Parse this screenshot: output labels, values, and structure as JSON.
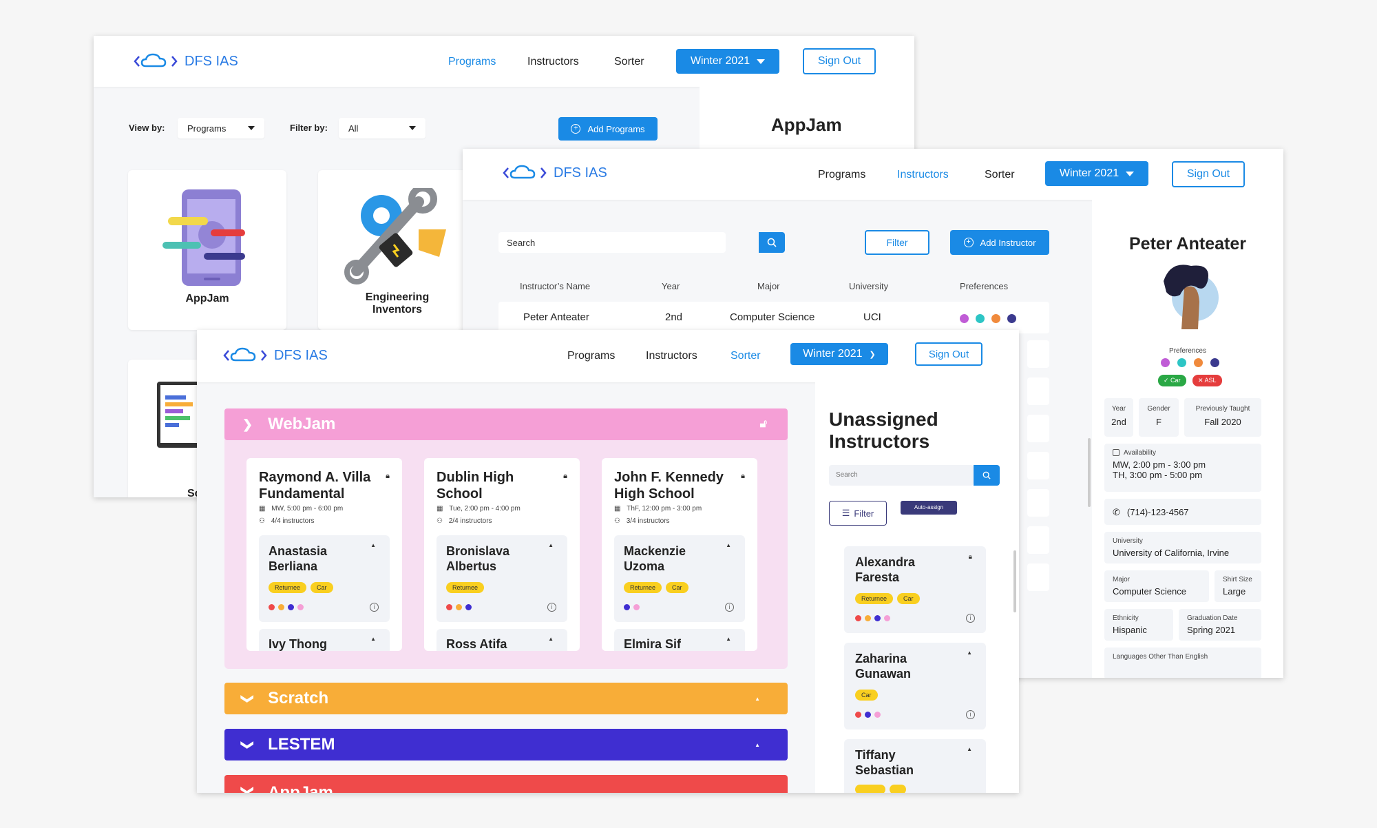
{
  "brand": "DFS IAS",
  "programs_window": {
    "nav": {
      "programs": "Programs",
      "instructors": "Instructors",
      "sorter": "Sorter",
      "term": "Winter 2021",
      "signout": "Sign Out"
    },
    "view_by_label": "View by:",
    "view_by_value": "Programs",
    "filter_by_label": "Filter by:",
    "filter_by_value": "All",
    "add_programs": "Add Programs",
    "cards": [
      {
        "name": "AppJam"
      },
      {
        "name": "Engineering Inventors"
      },
      {
        "name": "Sc"
      }
    ],
    "side_title": "AppJam"
  },
  "instructors_window": {
    "nav": {
      "programs": "Programs",
      "instructors": "Instructors",
      "sorter": "Sorter",
      "term": "Winter 2021",
      "signout": "Sign Out"
    },
    "search_placeholder": "Search",
    "filter": "Filter",
    "add_instructor": "Add Instructor",
    "columns": [
      "Instructor’s Name",
      "Year",
      "Major",
      "University",
      "Preferences"
    ],
    "rows": [
      {
        "name": "Peter Anteater",
        "year": "2nd",
        "major": "Computer Science",
        "university": "UCI",
        "pref_colors": [
          "#c05cd6",
          "#2dc5c5",
          "#f08a3c",
          "#3b3a8e"
        ]
      }
    ],
    "profile": {
      "name": "Peter Anteater",
      "preferences_label": "Preferences",
      "pref_colors": [
        "#c05cd6",
        "#2dc5c5",
        "#f08a3c",
        "#3b3a8e"
      ],
      "badge_car": "Car",
      "badge_asl": "ASL",
      "year_label": "Year",
      "year": "2nd",
      "gender_label": "Gender",
      "gender": "F",
      "prev_label": "Previously Taught",
      "prev": "Fall 2020",
      "availability_label": "Availability",
      "availability_1": "MW, 2:00 pm - 3:00 pm",
      "availability_2": "TH, 3:00 pm - 5:00 pm",
      "phone": "(714)-123-4567",
      "university_label": "University",
      "university": "University of California, Irvine",
      "major_label": "Major",
      "major": "Computer Science",
      "shirt_label": "Shirt Size",
      "shirt": "Large",
      "ethnicity_label": "Ethnicity",
      "ethnicity": "Hispanic",
      "grad_label": "Graduation Date",
      "grad": "Spring 2021",
      "languages_label": "Languages Other Than English"
    }
  },
  "sorter_window": {
    "nav": {
      "programs": "Programs",
      "instructors": "Instructors",
      "sorter": "Sorter",
      "term": "Winter 2021",
      "signout": "Sign Out"
    },
    "programs": [
      {
        "name": "WebJam",
        "color": "#f59fd6",
        "expanded": true
      },
      {
        "name": "Scratch",
        "color": "#f8ad38"
      },
      {
        "name": "LESTEM",
        "color": "#3f2ed1"
      },
      {
        "name": "AppJam",
        "color": "#ef4a4a"
      }
    ],
    "schools": [
      {
        "name": "Raymond A. Villa Fundamental",
        "time": "MW, 5:00 pm - 6:00 pm",
        "count": "4/4 instructors",
        "instructors": [
          {
            "name": "Anastasia Berliana",
            "tags": [
              "Returnee",
              "Car"
            ],
            "dots": [
              "#ef4a4a",
              "#f8ad38",
              "#3f2ed1",
              "#f59fd6"
            ]
          },
          {
            "name": "Ivy Thong"
          }
        ]
      },
      {
        "name": "Dublin High School",
        "time": "Tue, 2:00 pm - 4:00 pm",
        "count": "2/4 instructors",
        "instructors": [
          {
            "name": "Bronislava Albertus",
            "tags": [
              "Returnee"
            ],
            "dots": [
              "#ef4a4a",
              "#f8ad38",
              "#3f2ed1"
            ]
          },
          {
            "name": "Ross Atifa"
          }
        ]
      },
      {
        "name": "John F. Kennedy High School",
        "time": "ThF, 12:00 pm - 3:00 pm",
        "count": "3/4 instructors",
        "instructors": [
          {
            "name": "Mackenzie Uzoma",
            "tags": [
              "Returnee",
              "Car"
            ],
            "dots": [
              "#3f2ed1",
              "#f59fd6"
            ]
          },
          {
            "name": "Elmira Sif"
          }
        ]
      }
    ],
    "unassigned": {
      "title": "Unassigned Instructors",
      "search_placeholder": "Search",
      "filter": "Filter",
      "auto_assign": "Auto-assign",
      "instructors": [
        {
          "name": "Alexandra Faresta",
          "tags": [
            "Returnee",
            "Car"
          ],
          "dots": [
            "#ef4a4a",
            "#f8ad38",
            "#3f2ed1",
            "#f59fd6"
          ]
        },
        {
          "name": "Zaharina Gunawan",
          "tags": [
            "Car"
          ],
          "dots": [
            "#ef4a4a",
            "#3f2ed1",
            "#f59fd6"
          ]
        },
        {
          "name": "Tiffany Sebastian",
          "tags": []
        }
      ]
    }
  }
}
